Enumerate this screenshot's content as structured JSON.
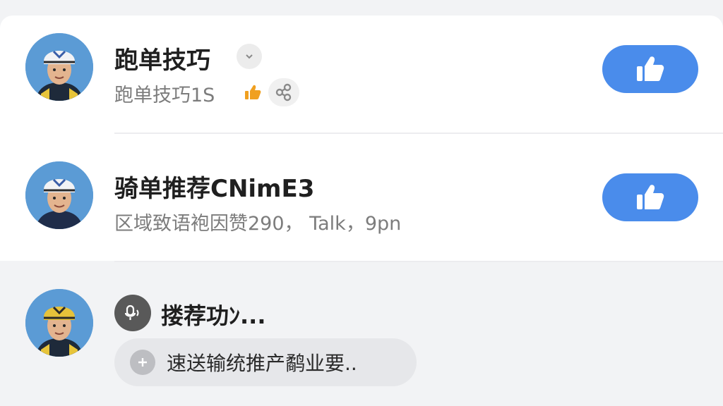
{
  "feed": {
    "items": [
      {
        "title": "跑单技巧",
        "subtitle": "跑单技巧1S",
        "avatar_helmet": "white"
      },
      {
        "title": "骑单推荐CNimE3",
        "subtitle": "区域致语袍因赞290， Talk，9pn",
        "avatar_helmet": "white"
      },
      {
        "title": "搂荐功ﾝ...",
        "input_text": "速送输统推产鹬业要..",
        "avatar_helmet": "yellow"
      }
    ]
  },
  "colors": {
    "accent": "#4a8ceb",
    "thumb_small": "#f0a020",
    "background": "#f2f3f5"
  },
  "icons": {
    "like": "thumbs-up-icon",
    "dropdown": "chevron-down-icon",
    "share": "share-icon",
    "mic": "voice-icon",
    "add": "plus-icon"
  }
}
